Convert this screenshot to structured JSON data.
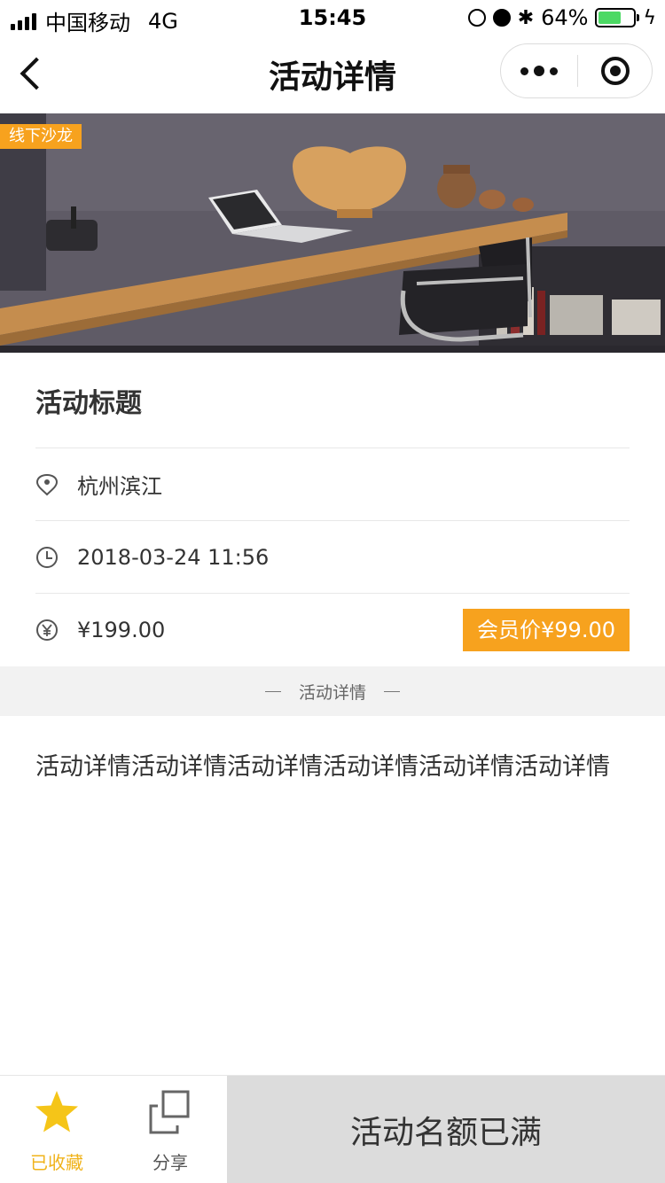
{
  "status_bar": {
    "carrier": "中国移动",
    "network": "4G",
    "time": "15:45",
    "battery": "64%",
    "battery_level": 0.64
  },
  "nav": {
    "title": "活动详情"
  },
  "banner": {
    "tag": "线下沙龙"
  },
  "event": {
    "title": "活动标题",
    "location": "杭州滨江",
    "datetime": "2018-03-24 11:56",
    "price": "¥199.00",
    "member_price": "会员价¥99.00"
  },
  "section": {
    "label": "活动详情"
  },
  "detail": {
    "text": "活动详情活动详情活动详情活动详情活动详情活动详情"
  },
  "bottom": {
    "fav_label": "已收藏",
    "share_label": "分享",
    "action_label": "活动名额已满"
  },
  "colors": {
    "accent": "#f7a21e",
    "star": "#f5c518",
    "disabled_bg": "#dcdcdc"
  },
  "icons": {
    "location": "location-pin-icon",
    "time": "clock-icon",
    "price": "yen-icon",
    "fav": "star-icon",
    "share": "share-icon"
  }
}
